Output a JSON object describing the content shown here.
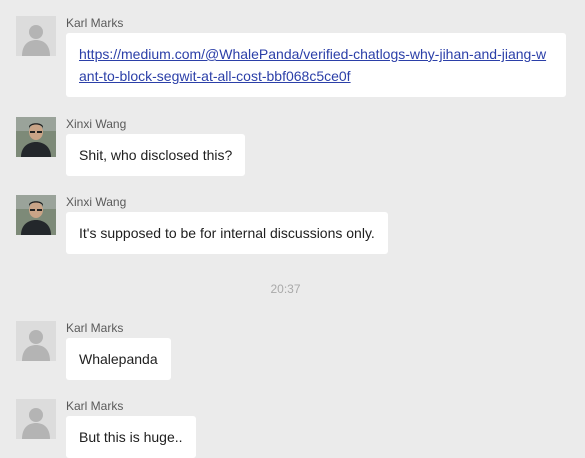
{
  "messages": [
    {
      "sender": "Karl Marks",
      "avatar": "default-avatar-icon",
      "link": "https://medium.com/@WhalePanda/verified-chatlogs-why-jihan-and-jiang-want-to-block-segwit-at-all-cost-bbf068c5ce0f"
    },
    {
      "sender": "Xinxi Wang",
      "avatar": "photo-avatar",
      "text": "Shit, who disclosed this?"
    },
    {
      "sender": "Xinxi Wang",
      "avatar": "photo-avatar",
      "text": "It's supposed to be for internal discussions only."
    },
    {
      "sender": "Karl Marks",
      "avatar": "default-avatar-icon",
      "text": "Whalepanda"
    },
    {
      "sender": "Karl Marks",
      "avatar": "default-avatar-icon",
      "text": "But this is huge.."
    }
  ],
  "timestamp": "20:37",
  "colors": {
    "background": "#ebebeb",
    "bubble": "#ffffff",
    "link": "#2b3fa8",
    "timestamp": "#a9a9a9"
  }
}
